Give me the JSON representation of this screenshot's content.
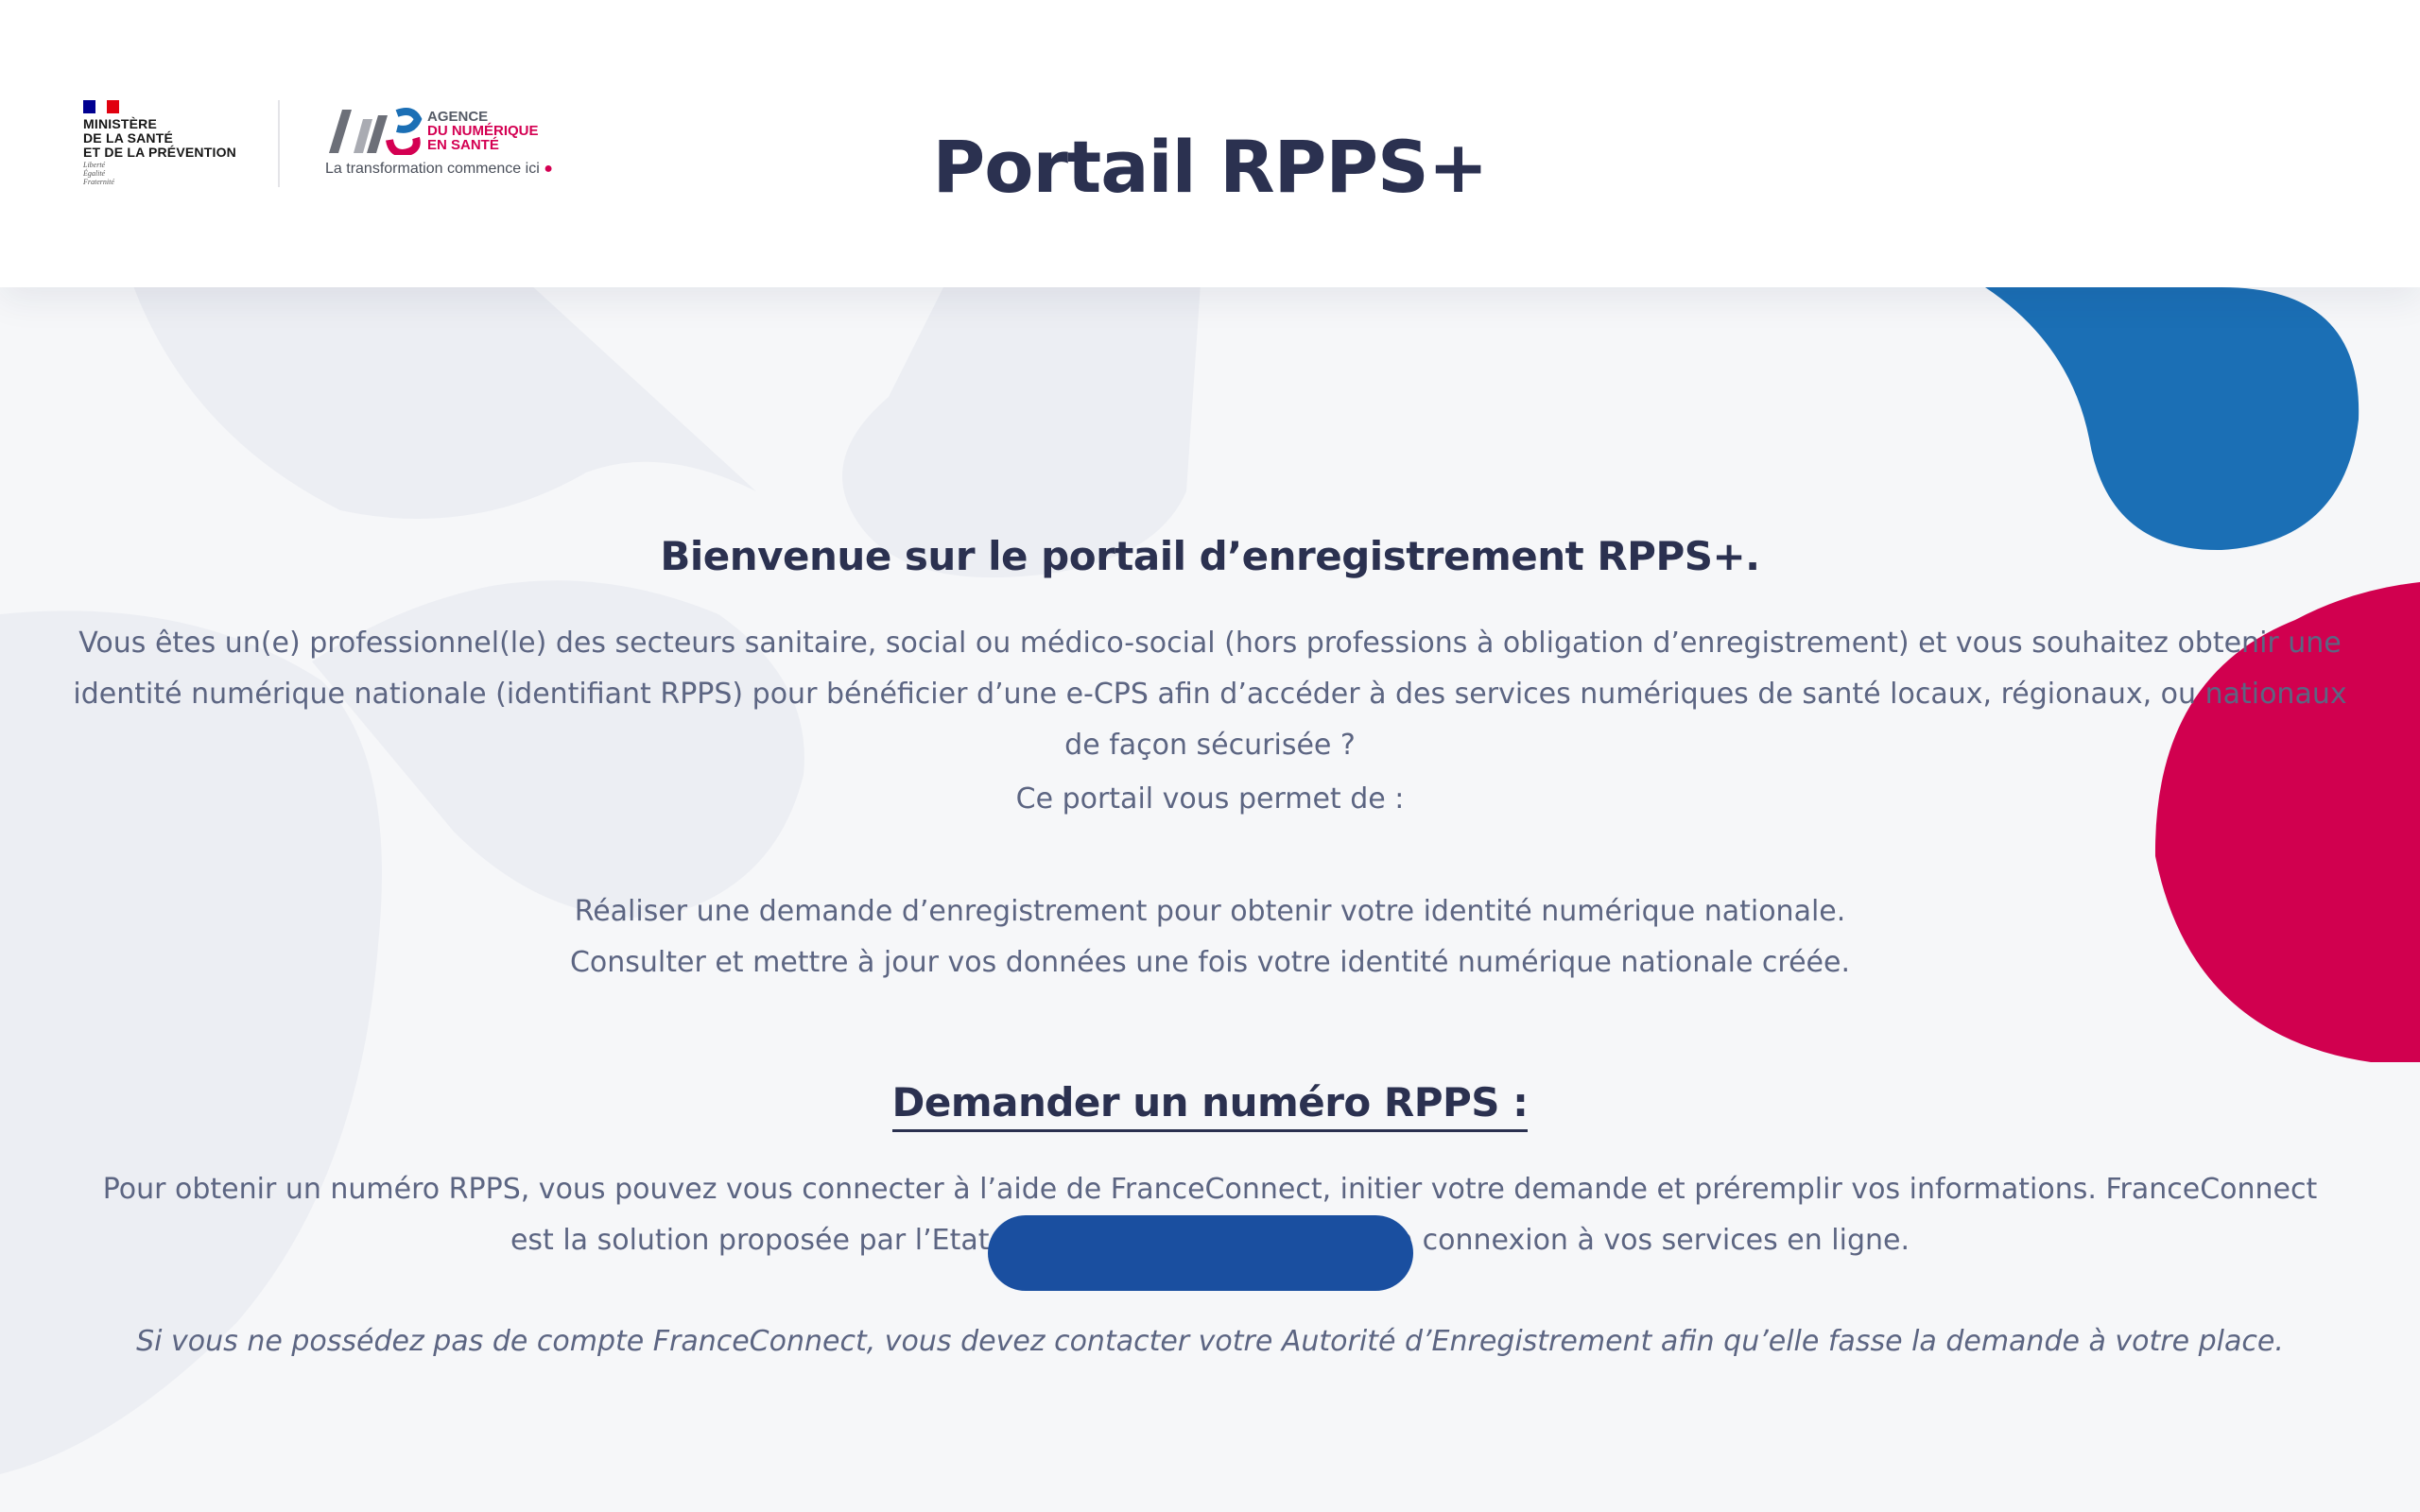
{
  "header": {
    "gov_logo_text": "MINISTÈRE\nDE LA SANTÉ\nET DE LA PRÉVENTION",
    "gov_motto": "Liberté\nÉgalité\nFraternité",
    "agency_line1": "AGENCE",
    "agency_line2": "DU NUMÉRIQUE",
    "agency_line3": "EN SANTÉ",
    "agency_tagline": "La transformation commence ici",
    "title": "Portail RPPS+"
  },
  "main": {
    "welcome_heading": "Bienvenue sur le portail d’enregistrement RPPS+.",
    "intro": "Vous êtes un(e) professionnel(le) des secteurs sanitaire, social ou médico-social (hors professions à obligation d’enregistrement) et vous souhaitez obtenir une identité numérique nationale (identifiant RPPS) pour bénéficier d’une e-CPS afin d’accéder à des services numériques de santé locaux, régionaux, ou nationaux de façon sécurisée ?",
    "lead": "Ce portail vous permet de :",
    "features": [
      "Réaliser une demande d’enregistrement pour obtenir votre identité numérique nationale.",
      "Consulter et mettre à jour vos données une fois votre identité numérique nationale créée."
    ],
    "request_heading": "Demander un numéro RPPS :",
    "franceconnect_info": "Pour obtenir un numéro RPPS, vous pouvez vous connecter à l’aide de FranceConnect, initier votre demande et préremplir vos informations. FranceConnect est la solution proposée par l’Etat pour sécuriser et simplifier la connexion à vos services en ligne.",
    "no_account_note": "Si vous ne possédez pas de compte FranceConnect, vous devez contacter votre Autorité d’Enregistrement afin qu’elle fasse la demande à votre place."
  },
  "colors": {
    "title": "#2b3150",
    "body_text": "#5c6582",
    "accent_blue": "#1b6fb5",
    "accent_red": "#d1004f",
    "button_blue": "#1a4fa0"
  }
}
